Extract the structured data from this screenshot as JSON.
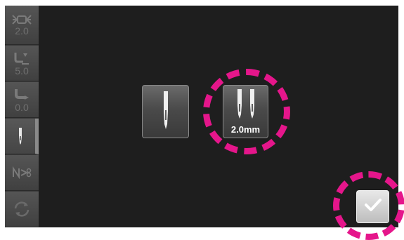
{
  "sidebar": {
    "items": [
      {
        "icon": "stitch-width-icon",
        "value": "2.0"
      },
      {
        "icon": "stitch-length-icon",
        "value": "5.0"
      },
      {
        "icon": "presser-foot-height-icon",
        "value": "0.0"
      },
      {
        "icon": "single-needle-icon",
        "value": "",
        "active": true
      },
      {
        "icon": "thread-cutter-icon",
        "value": ""
      },
      {
        "icon": "reset-icon",
        "value": ""
      }
    ]
  },
  "needle_options": {
    "single": {
      "icon": "single-needle-icon"
    },
    "twin": {
      "icon": "twin-needle-icon",
      "label": "2.0mm",
      "selected": true
    }
  },
  "confirm": {
    "icon": "checkmark-icon"
  },
  "colors": {
    "highlight": "#e5168b",
    "screen_bg": "#1e1e1e",
    "sidebar_bg": "#3a3a3a"
  }
}
